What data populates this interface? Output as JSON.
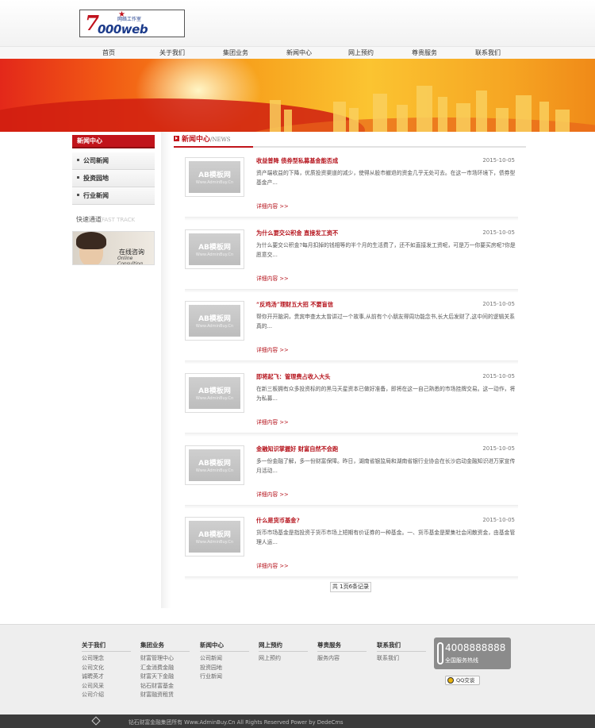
{
  "logo": {
    "mark": "7",
    "brand": "000web",
    "subtitle": "网络工作室"
  },
  "nav": [
    "首页",
    "关于我们",
    "集团业务",
    "新闻中心",
    "网上预约",
    "尊贵服务",
    "联系我们"
  ],
  "sidebar": {
    "title": "新闻中心",
    "items": [
      "公司新闻",
      "投资园地",
      "行业新闻"
    ],
    "fast_track": "快速通道",
    "fast_track_en": "FAST TRACK",
    "consult_cn": "在线咨询",
    "consult_en": "Online Consulting"
  },
  "main": {
    "title": "新闻中心",
    "title_en": "/NEWS",
    "thumb_text": "AB模板网",
    "thumb_sub": "Www.AdminBuy.Cn",
    "more_label": "详细内容 >>",
    "news": [
      {
        "title": "收益普降 债券型私募基金能否成",
        "date": "2015-10-05",
        "desc": "资产端收益的下降，优质投资渠道的减少，使得从股市撤退的资金几乎无处可去。在这一市场环境下，债券型基金产..."
      },
      {
        "title": "为什么要交公积金 直接发工资不",
        "date": "2015-10-05",
        "desc": "为什么要交公积金?每月扣掉的钱相等的半个月的生活费了，还不如直接发工资呢，可是万一你要买房呢?你是愿意交..."
      },
      {
        "title": "“反鸡汤”理财五大招 不要盲信",
        "date": "2015-10-05",
        "desc": "帮你开开脑洞，贵宾申查太太曾讲过一个故事,从前有个小朋友得周功能念书,长大后发财了,这中间的逻辑关系真的..."
      },
      {
        "title": "即将起飞：管理费占收入大头",
        "date": "2015-10-05",
        "desc": "在新三板拥有众多投资标的的黑马天星资本已做好准备，即将在这一自己熟悉的市场挂牌交易。这一动作，将为私募..."
      },
      {
        "title": "金融知识掌握好 财富自然不会跑",
        "date": "2015-10-05",
        "desc": "多一份金融了解，多一份财富保障。昨日，湖南省银监局和湖南省银行业协会在长沙启动金融知识进万家宣传月活动..."
      },
      {
        "title": "什么是货币基金?",
        "date": "2015-10-05",
        "desc": "货币市场基金是指投资于货币市场上短期有价证券的一种基金。一、货币基金是聚集社会闲散资金，由基金管理人运..."
      }
    ],
    "pager": "共 1页6条记录"
  },
  "footer": {
    "columns": [
      {
        "heading": "关于我们",
        "links": [
          "公司理念",
          "公司文化",
          "诚聘英才",
          "公司风采",
          "公司介绍"
        ]
      },
      {
        "heading": "集团业务",
        "links": [
          "财富管理中心",
          "汇金消费金融",
          "财富天下金融",
          "钻石财富基金",
          "财富融资租赁"
        ]
      },
      {
        "heading": "新闻中心",
        "links": [
          "公司新闻",
          "投资园地",
          "行业新闻"
        ]
      },
      {
        "heading": "网上预约",
        "links": [
          "网上预约"
        ]
      },
      {
        "heading": "尊贵服务",
        "links": [
          "服务内容"
        ]
      },
      {
        "heading": "联系我们",
        "links": [
          "联系我们"
        ]
      }
    ],
    "hotline_number": "4008888888",
    "hotline_caption": "全国服务热线",
    "qq_label": "QQ交谈",
    "copyright": "钻石财富金融集团所有 Www.AdminBuy.Cn All Rights Reserved  Power by DedeCms"
  },
  "colors": {
    "accent": "#c1141b",
    "footer_bg": "#eeeeee",
    "copybar_bg": "#3b3b3b"
  }
}
